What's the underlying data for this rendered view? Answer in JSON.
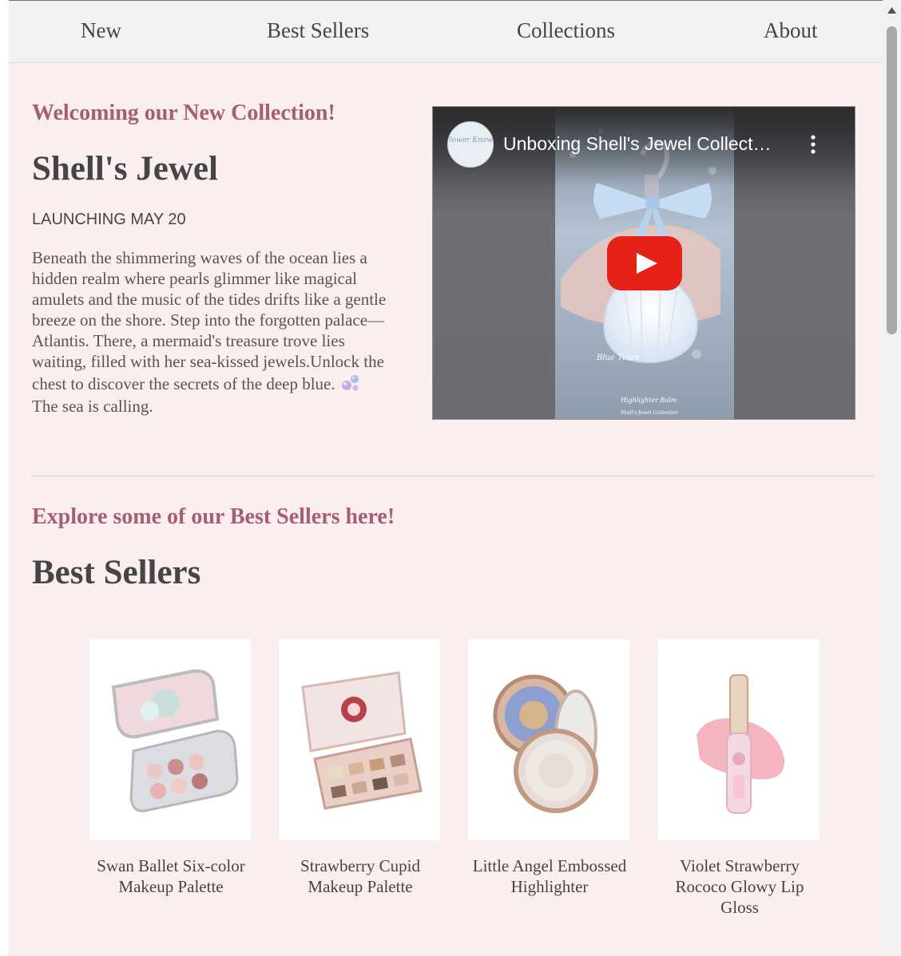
{
  "nav": {
    "items": [
      "New",
      "Best Sellers",
      "Collections",
      "About"
    ]
  },
  "new_collection": {
    "kicker": "Welcoming our New Collection!",
    "title": "Shell's Jewel",
    "launch": "LAUNCHING MAY 20",
    "description_lines": [
      "Beneath the shimmering waves of the ocean lies a",
      "hidden realm where pearls glimmer like magical",
      "amulets and the music of the tides drifts like a gentle",
      "breeze on the shore. Step into the forgotten palace—",
      "Atlantis. There, a mermaid's treasure trove lies",
      "waiting, filled with her sea-kissed jewels.Unlock the",
      "chest to discover the secrets of the deep blue.",
      "The sea is calling."
    ],
    "emoji_icon": "bubbles-icon"
  },
  "video": {
    "title": "Unboxing Shell's Jewel Collect…",
    "channel_name": "Flower Knows",
    "overlay_text_1": "Blue Tears",
    "overlay_text_2": "Highlighter Balm",
    "overlay_text_3": "Shell's Jewel Collection",
    "play_icon": "youtube-play-icon",
    "menu_icon": "more-vertical-icon"
  },
  "best_sellers": {
    "kicker": "Explore some of our Best Sellers here!",
    "title": "Best Sellers",
    "products": [
      {
        "name_lines": [
          "Swan Ballet Six-color",
          "Makeup Palette"
        ],
        "image": "eyeshadow-palette-image"
      },
      {
        "name_lines": [
          "Strawberry Cupid",
          "Makeup Palette"
        ],
        "image": "makeup-palette-image"
      },
      {
        "name_lines": [
          "Little Angel Embossed",
          "Highlighter"
        ],
        "image": "compact-highlighter-image"
      },
      {
        "name_lines": [
          "Violet Strawberry",
          "Rococo Glowy Lip",
          "Gloss"
        ],
        "image": "lip-gloss-image"
      }
    ]
  },
  "colors": {
    "accent": "#a65e77",
    "page_background": "#fbeeef",
    "nav_background": "#f2f2f2",
    "heading_text": "#454545",
    "youtube_red": "#ff0000"
  }
}
